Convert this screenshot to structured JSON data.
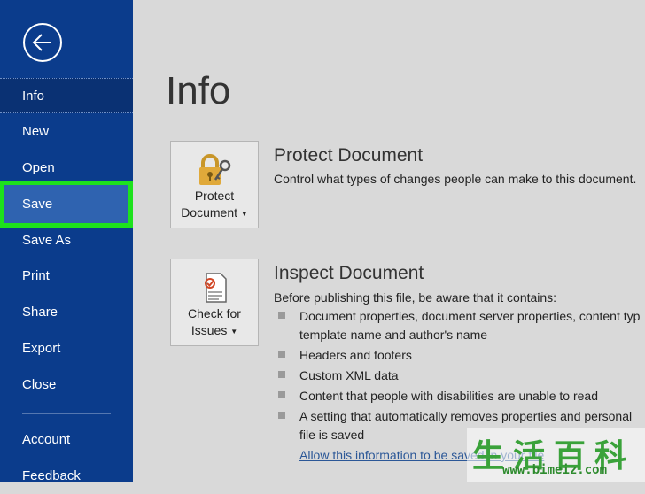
{
  "nav": {
    "items": [
      "Info",
      "New",
      "Open",
      "Save",
      "Save As",
      "Print",
      "Share",
      "Export",
      "Close"
    ],
    "footer_items": [
      "Account",
      "Feedback"
    ]
  },
  "main": {
    "title": "Info",
    "protect": {
      "button_line1": "Protect",
      "button_line2": "Document",
      "title": "Protect Document",
      "description": "Control what types of changes people can make to this document."
    },
    "inspect": {
      "button_line1": "Check for",
      "button_line2": "Issues",
      "title": "Inspect Document",
      "intro": "Before publishing this file, be aware that it contains:",
      "bullets": [
        "Document properties, document server properties, content typ",
        "template name and author's name",
        "Headers and footers",
        "Custom XML data",
        "Content that people with disabilities are unable to read",
        "A setting that automatically removes properties and personal",
        "file is saved"
      ],
      "link": "Allow this information to be saved in your file"
    }
  },
  "watermark": {
    "glyphs": [
      "生",
      "活",
      "百",
      "科"
    ],
    "url": "www.bimeiz.com"
  },
  "colors": {
    "sidebar": "#0b3c8c",
    "highlight_border": "#1de21d",
    "background": "#d9d9d9"
  }
}
